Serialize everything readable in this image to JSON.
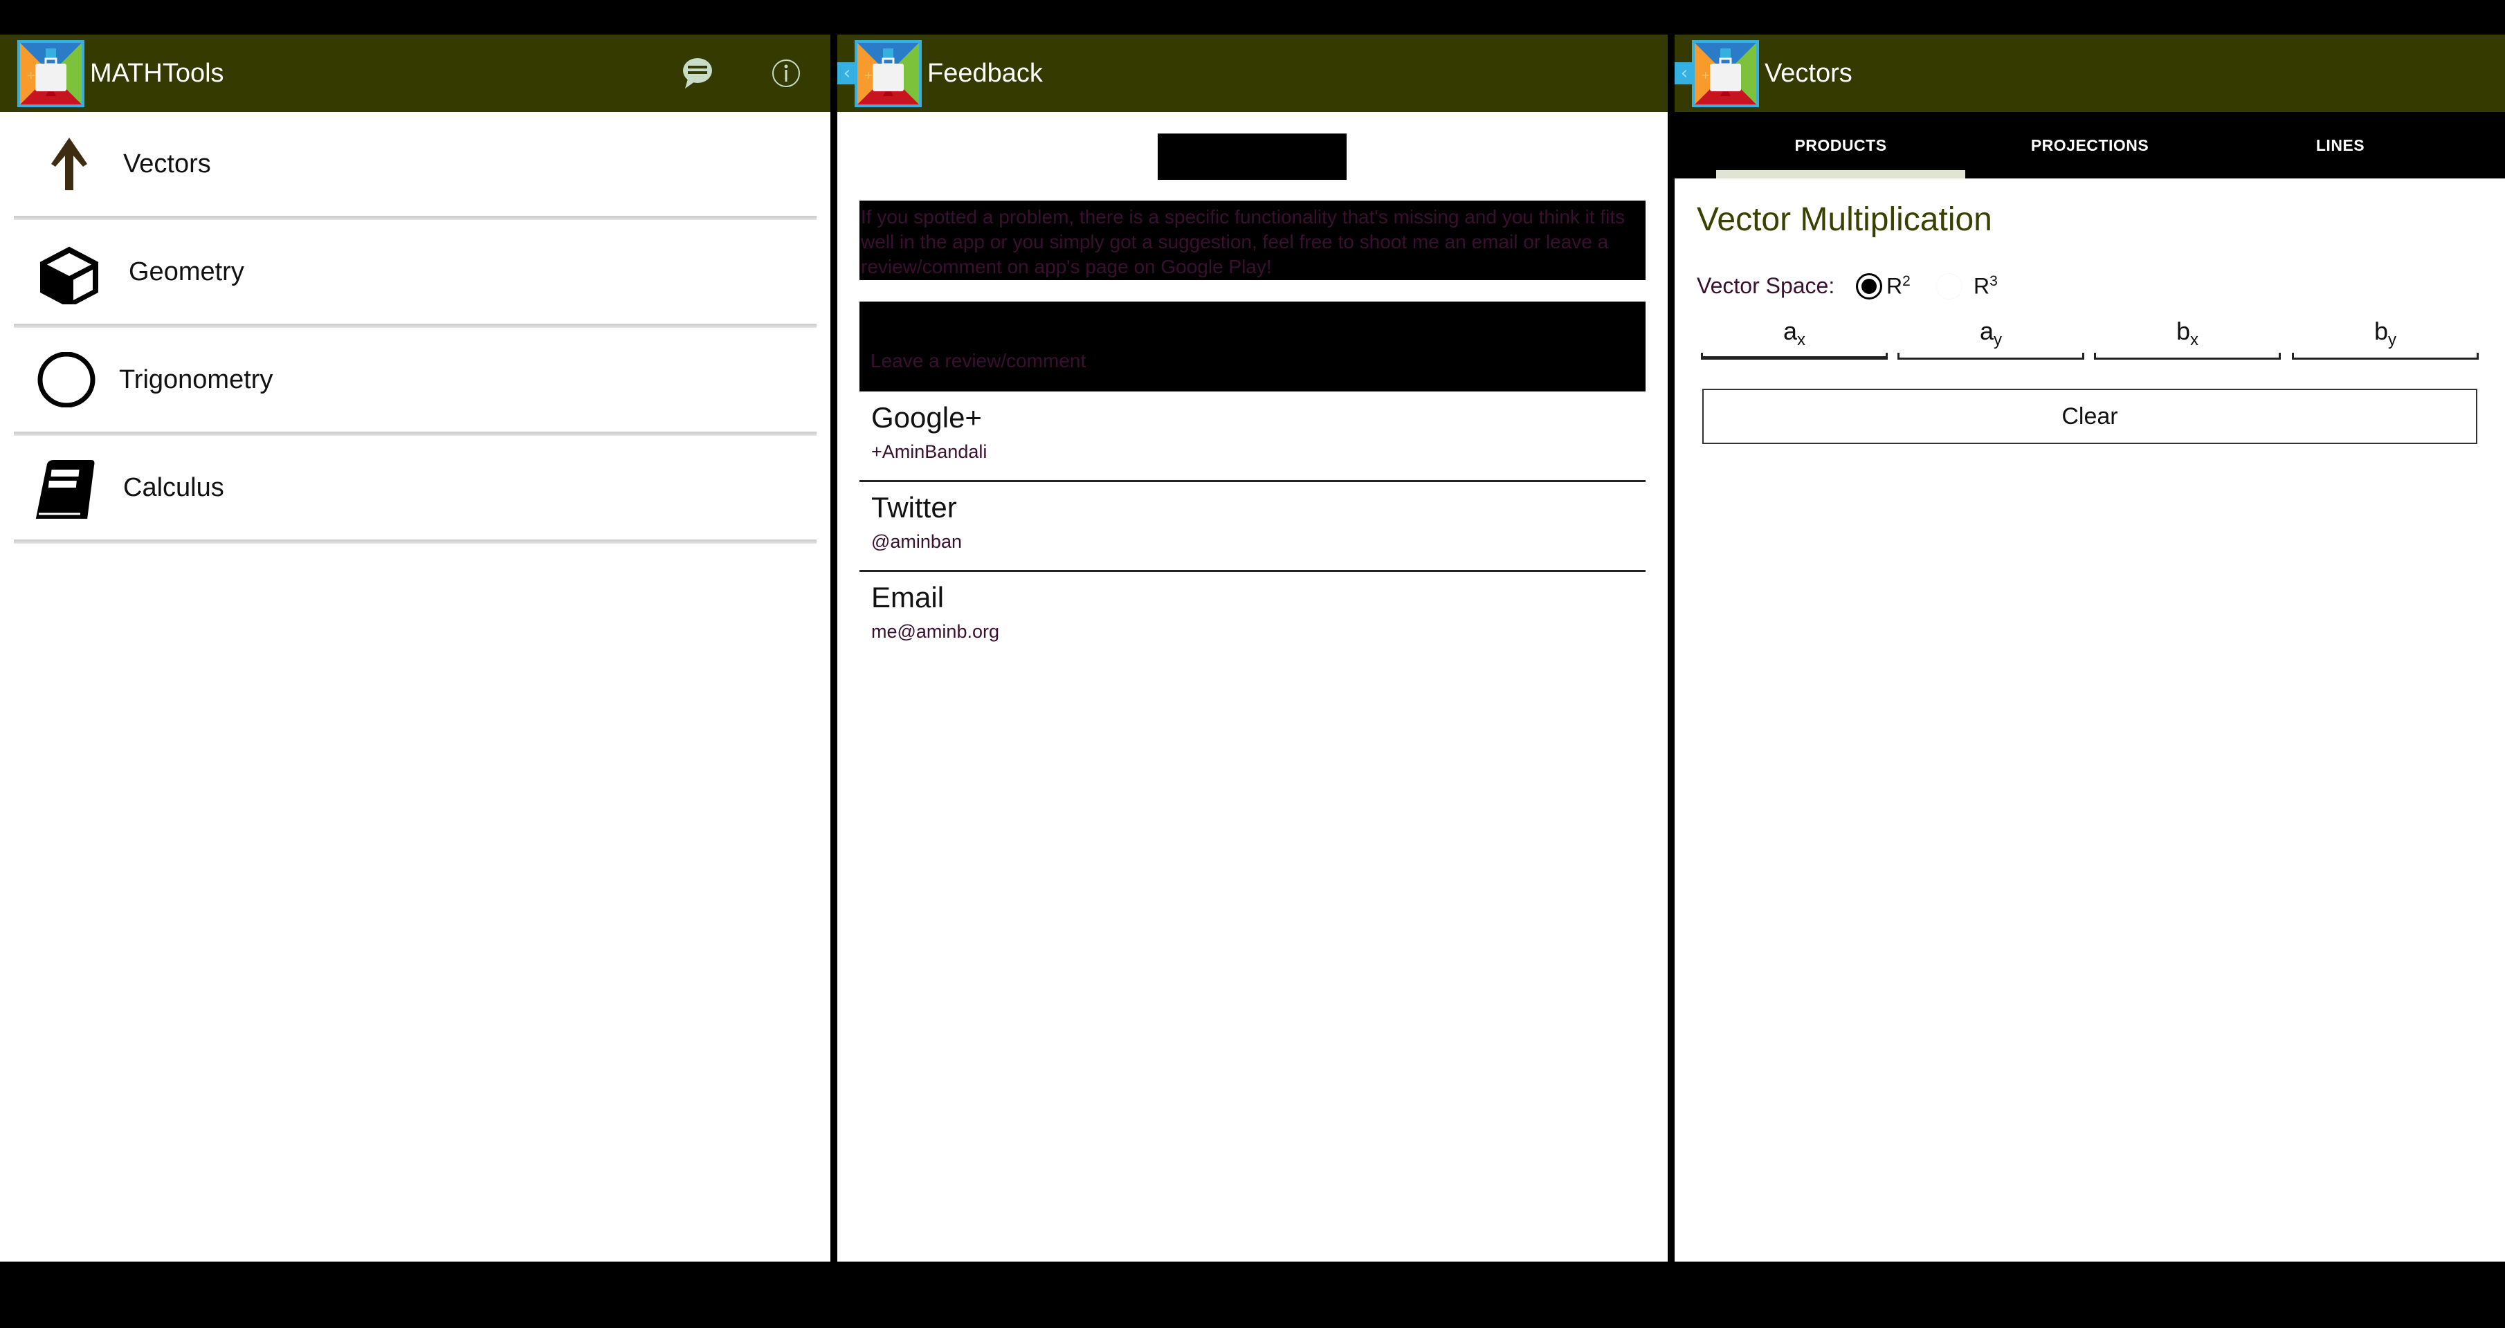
{
  "colors": {
    "header_bg": "#343a00",
    "header_icon": "#c8dcc8",
    "accent_title": "#3a4000",
    "secondary_text": "#3a1030",
    "tab_indicator": "#e0e4d2",
    "logo_frame": "#36b0e0"
  },
  "panel1": {
    "header": {
      "title": "MATHTools",
      "icons": [
        "chat-bubble-icon",
        "info-icon"
      ]
    },
    "categories": [
      {
        "label": "Vectors",
        "icon": "arrow-up-icon"
      },
      {
        "label": "Geometry",
        "icon": "cube-icon"
      },
      {
        "label": "Trigonometry",
        "icon": "circle-icon"
      },
      {
        "label": "Calculus",
        "icon": "book-icon"
      }
    ]
  },
  "panel2": {
    "header": {
      "title": "Feedback",
      "back_icon": "chevron-left-icon"
    },
    "message": "If you spotted a problem, there is a specific functionality that's missing and you think it fits well in the app or you simply got a suggestion, feel free to shoot me an email or leave a review/comment on app's page on Google Play!",
    "review_input": {
      "value": "",
      "placeholder": "Leave a review/comment"
    },
    "contacts": [
      {
        "title": "Google+",
        "subtitle": "+AminBandali"
      },
      {
        "title": "Twitter",
        "subtitle": "@aminban"
      },
      {
        "title": "Email",
        "subtitle": "me@aminb.org"
      }
    ]
  },
  "panel3": {
    "header": {
      "title": "Vectors",
      "back_icon": "chevron-left-icon"
    },
    "tabs": [
      {
        "label": "PRODUCTS",
        "active": true
      },
      {
        "label": "PROJECTIONS",
        "active": false
      },
      {
        "label": "LINES",
        "active": false
      }
    ],
    "section_title": "Vector Multiplication",
    "vector_space": {
      "label": "Vector Space:",
      "options": [
        {
          "base": "R",
          "exp": "2",
          "selected": true
        },
        {
          "base": "R",
          "exp": "3",
          "selected": false
        }
      ]
    },
    "inputs": [
      {
        "base": "a",
        "sub": "x",
        "value": ""
      },
      {
        "base": "a",
        "sub": "y",
        "value": ""
      },
      {
        "base": "b",
        "sub": "x",
        "value": ""
      },
      {
        "base": "b",
        "sub": "y",
        "value": ""
      }
    ],
    "clear_label": "Clear"
  }
}
